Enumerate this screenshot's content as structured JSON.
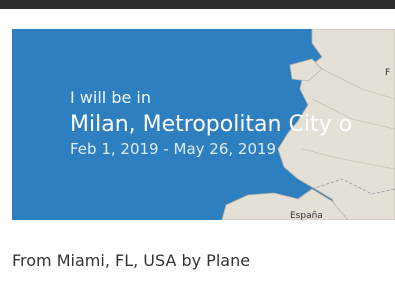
{
  "trip": {
    "intro": "I will be in",
    "city": "Milan, Metropolitan City o",
    "dates": "Feb 1, 2019 - May 26, 2019",
    "route": "From Miami, FL, USA by Plane"
  },
  "map": {
    "label_spain": "España",
    "label_france_partial": "F",
    "sea_color": "#2e7fbf",
    "land_color": "#e4e0d6"
  }
}
